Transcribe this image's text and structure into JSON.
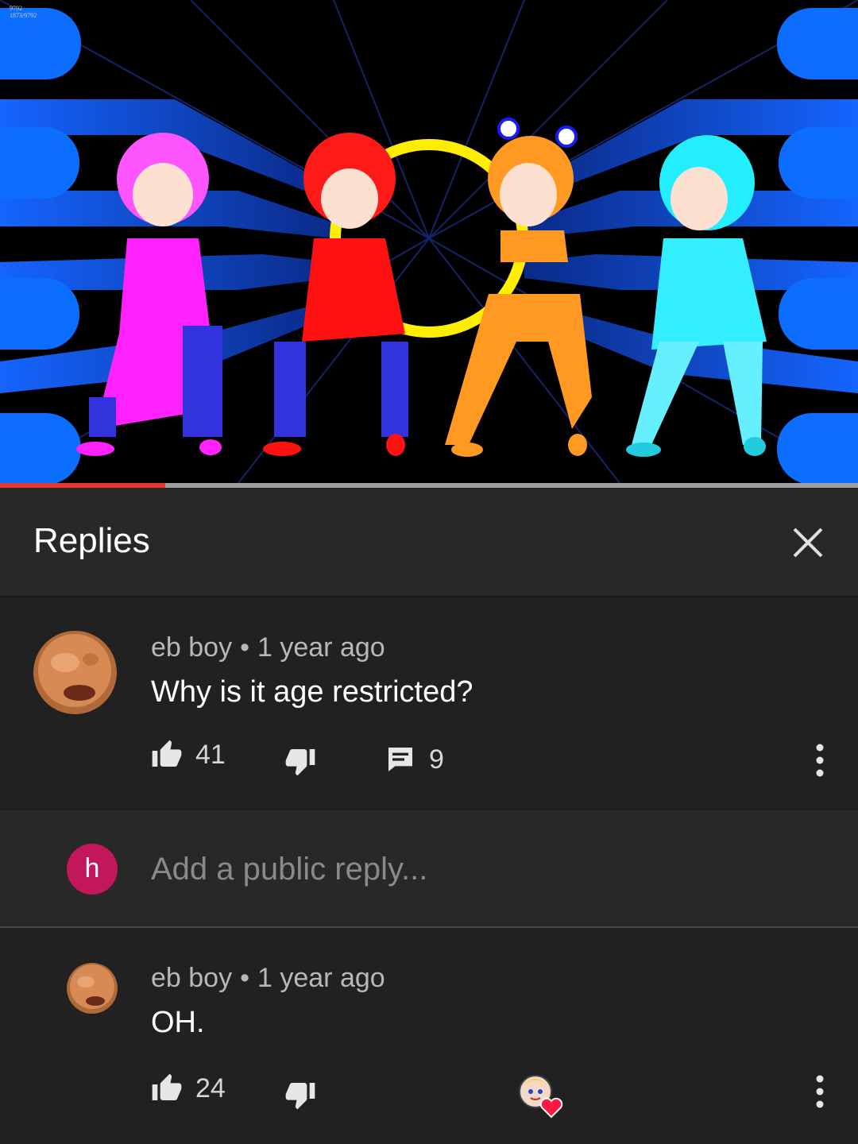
{
  "video": {
    "corner_text_line1": "9792",
    "corner_text_line2": "1873/9792",
    "progress_fraction": 0.193,
    "progress_color": "#e53935"
  },
  "replies_panel": {
    "title": "Replies",
    "close_icon": "close-icon"
  },
  "parent_comment": {
    "author": "eb boy",
    "separator": "•",
    "time": "1 year ago",
    "text": "Why is it age restricted?",
    "likes": "41",
    "replies": "9",
    "icons": [
      "thumb-up-icon",
      "thumb-down-icon",
      "comment-icon",
      "more-vert-icon"
    ]
  },
  "reply_input": {
    "avatar_letter": "h",
    "avatar_color": "#c2185b",
    "placeholder": "Add a public reply..."
  },
  "reply": {
    "author": "eb boy",
    "separator": "•",
    "time": "1 year ago",
    "text": "OH.",
    "likes": "24",
    "icons": [
      "thumb-up-icon",
      "thumb-down-icon",
      "creator-heart-icon",
      "more-vert-icon"
    ]
  }
}
